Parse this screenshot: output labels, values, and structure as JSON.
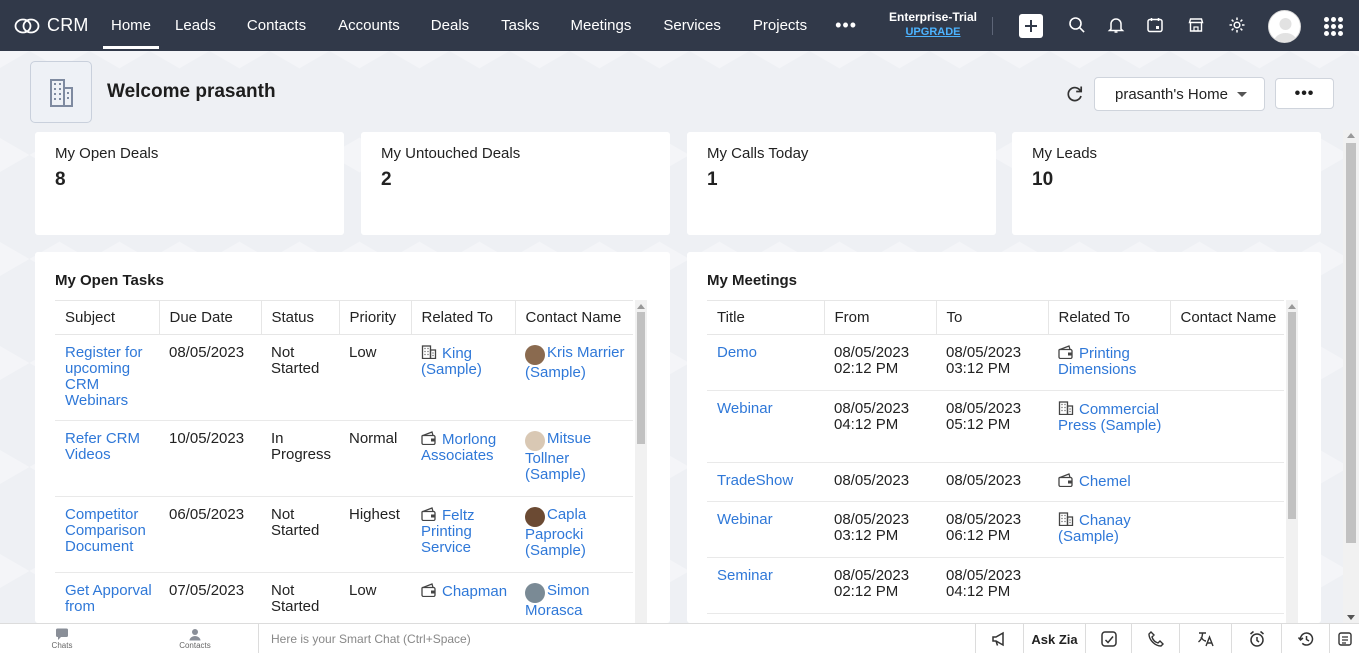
{
  "nav": {
    "brand": "CRM",
    "tabs": [
      {
        "label": "Home",
        "active": true
      },
      {
        "label": "Leads",
        "active": false
      },
      {
        "label": "Contacts",
        "active": false
      },
      {
        "label": "Accounts",
        "active": false
      },
      {
        "label": "Deals",
        "active": false
      },
      {
        "label": "Tasks",
        "active": false
      },
      {
        "label": "Meetings",
        "active": false
      },
      {
        "label": "Services",
        "active": false
      },
      {
        "label": "Projects",
        "active": false
      }
    ],
    "more": "•••",
    "edition": "Enterprise-Trial",
    "upgrade": "UPGRADE",
    "icons": [
      "add-icon",
      "search-icon",
      "bell-icon",
      "calendar-icon",
      "marketplace-icon",
      "gear-icon",
      "avatar",
      "apps-grid-icon"
    ]
  },
  "header": {
    "welcome": "Welcome prasanth",
    "home_selector": "prasanth's Home",
    "more_button": "•••"
  },
  "kpis": [
    {
      "label": "My Open Deals",
      "value": "8"
    },
    {
      "label": "My Untouched Deals",
      "value": "2"
    },
    {
      "label": "My Calls Today",
      "value": "1"
    },
    {
      "label": "My Leads",
      "value": "10"
    }
  ],
  "tasks": {
    "title": "My Open Tasks",
    "columns": [
      "Subject",
      "Due Date",
      "Status",
      "Priority",
      "Related To",
      "Contact Name"
    ],
    "rows": [
      {
        "subject": "Register for upcoming CRM Webinars",
        "due": "08/05/2023",
        "status": "Not Started",
        "priority": "Low",
        "related": "King (Sample)",
        "related_icon": "building-icon",
        "contact": "Kris Marrier (Sample)",
        "avatar_color": "#8a6a4f"
      },
      {
        "subject": "Refer CRM Videos",
        "due": "10/05/2023",
        "status": "In Progress",
        "priority": "Normal",
        "related": "Morlong Associates",
        "related_icon": "deal-icon",
        "contact": "Mitsue Tollner (Sample)",
        "avatar_color": "#d9c8b4"
      },
      {
        "subject": "Competitor Comparison Document",
        "due": "06/05/2023",
        "status": "Not Started",
        "priority": "Highest",
        "related": "Feltz Printing Service",
        "related_icon": "deal-icon",
        "contact": "Capla Paprocki (Sample)",
        "avatar_color": "#6b4a33"
      },
      {
        "subject": "Get Apporval from",
        "due": "07/05/2023",
        "status": "Not Started",
        "priority": "Low",
        "related": "Chapman",
        "related_icon": "deal-icon",
        "contact": "Simon Morasca",
        "avatar_color": "#7a8a95"
      }
    ]
  },
  "meetings": {
    "title": "My Meetings",
    "columns": [
      "Title",
      "From",
      "To",
      "Related To",
      "Contact Name"
    ],
    "rows": [
      {
        "title": "Demo",
        "from": "08/05/2023 02:12 PM",
        "to": "08/05/2023 03:12 PM",
        "related": "Printing Dimensions",
        "related_icon": "deal-icon",
        "contact": ""
      },
      {
        "title": "Webinar",
        "from": "08/05/2023 04:12 PM",
        "to": "08/05/2023 05:12 PM",
        "related": "Commercial Press (Sample)",
        "related_icon": "building-icon",
        "contact": ""
      },
      {
        "title": "TradeShow",
        "from": "08/05/2023",
        "to": "08/05/2023",
        "related": "Chemel",
        "related_icon": "deal-icon",
        "contact": ""
      },
      {
        "title": "Webinar",
        "from": "08/05/2023 03:12 PM",
        "to": "08/05/2023 06:12 PM",
        "related": "Chanay (Sample)",
        "related_icon": "building-icon",
        "contact": ""
      },
      {
        "title": "Seminar",
        "from": "08/05/2023 02:12 PM",
        "to": "08/05/2023 04:12 PM",
        "related": "",
        "related_icon": "",
        "contact": ""
      }
    ]
  },
  "bottombar": {
    "chats": "Chats",
    "contacts": "Contacts",
    "smartchat_placeholder": "Here is your Smart Chat (Ctrl+Space)",
    "ask_zia": "Ask Zia"
  }
}
